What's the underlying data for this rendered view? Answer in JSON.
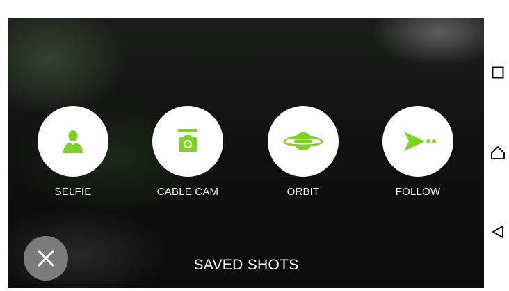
{
  "shots": [
    {
      "label": "SELFIE",
      "icon": "person-icon"
    },
    {
      "label": "CABLE CAM",
      "icon": "camera-cable-icon"
    },
    {
      "label": "ORBIT",
      "icon": "planet-icon"
    },
    {
      "label": "FOLLOW",
      "icon": "follow-arrow-icon"
    }
  ],
  "footer": {
    "saved_shots_label": "SAVED SHOTS",
    "close_icon": "close-icon"
  },
  "system_nav": {
    "recents_icon": "recents-square-icon",
    "home_icon": "home-icon",
    "back_icon": "back-triangle-icon"
  },
  "colors": {
    "accent": "#7ED321",
    "circle_bg": "#FFFFFF",
    "close_bg": "#7B7B7B",
    "label_text": "#F2F2F2",
    "background": "#101110"
  }
}
